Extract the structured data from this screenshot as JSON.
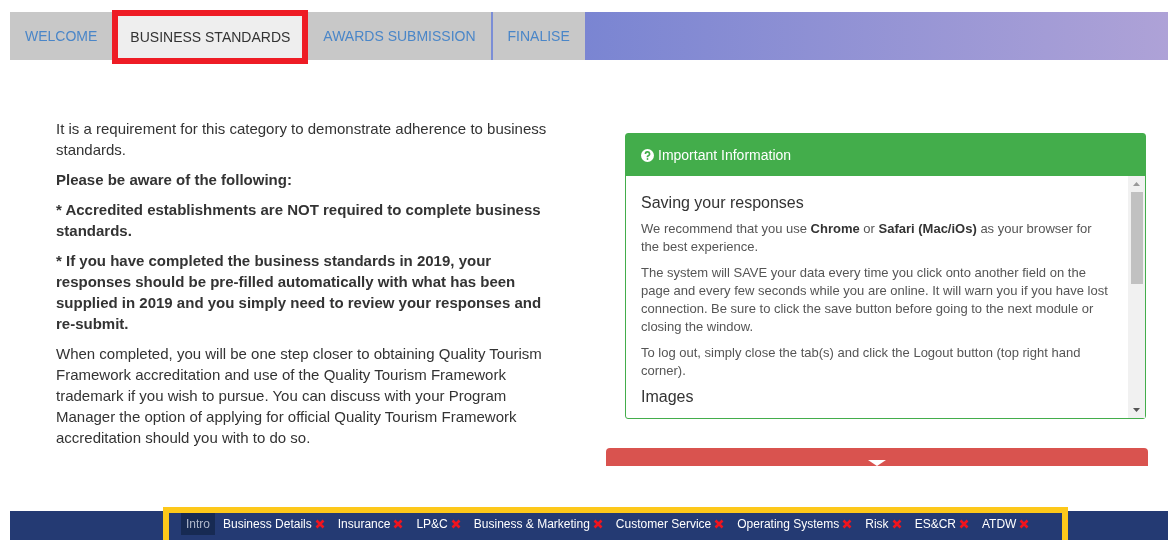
{
  "tabs": [
    {
      "label": "WELCOME",
      "selected": false
    },
    {
      "label": "BUSINESS STANDARDS",
      "selected": true
    },
    {
      "label": "AWARDS SUBMISSION",
      "selected": false
    },
    {
      "label": "FINALISE",
      "selected": false
    }
  ],
  "intro": {
    "paragraphs": [
      {
        "text": "It is a requirement for this category to demonstrate adherence to business standards.",
        "bold": false
      },
      {
        "text": "Please be aware of the following:",
        "bold": true
      },
      {
        "text": "* Accredited establishments are NOT required to complete business standards.",
        "bold": true
      },
      {
        "text": "* If you have completed the business standards in 2019, your responses should be pre-filled automatically with what has been supplied in 2019 and you simply need to review your responses and re-submit.",
        "bold": true
      },
      {
        "text": "When completed, you will be one step closer to obtaining Quality Tourism Framework accreditation and use of the Quality Tourism Framework trademark if you wish to pursue. You can discuss with your Program Manager the option of applying for official Quality Tourism Framework accreditation should you with to do so.",
        "bold": false
      }
    ]
  },
  "info_panel": {
    "title": "Important Information",
    "heading": "Saving your responses",
    "paragraphs": [
      "We recommend that you use **Chrome** or **Safari (Mac/iOs)** as your browser for the best experience.",
      "The system will SAVE your data every time you click onto another field on the page and every few seconds while you are online. It will warn you if you have lost connection. Be sure to click the save button before going to the next module or closing the window.",
      "To log out, simply close the tab(s) and click the Logout button (top right hand corner)."
    ],
    "next_heading": "Images"
  },
  "module_nav": [
    {
      "label": "Intro",
      "selected": true,
      "incomplete": false
    },
    {
      "label": "Business Details",
      "selected": false,
      "incomplete": true
    },
    {
      "label": "Insurance",
      "selected": false,
      "incomplete": true
    },
    {
      "label": "LP&C",
      "selected": false,
      "incomplete": true
    },
    {
      "label": "Business & Marketing",
      "selected": false,
      "incomplete": true
    },
    {
      "label": "Customer Service",
      "selected": false,
      "incomplete": true
    },
    {
      "label": "Operating Systems",
      "selected": false,
      "incomplete": true
    },
    {
      "label": "Risk",
      "selected": false,
      "incomplete": true
    },
    {
      "label": "ES&CR",
      "selected": false,
      "incomplete": true
    },
    {
      "label": "ATDW",
      "selected": false,
      "incomplete": true
    }
  ]
}
